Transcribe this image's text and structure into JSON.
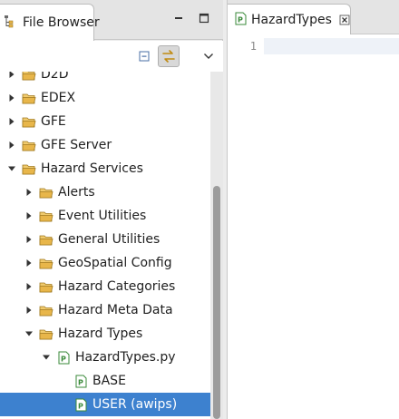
{
  "left_panel": {
    "tab_label": "File Browser",
    "tree": [
      {
        "label": "D2D",
        "depth": 0,
        "expanded": false,
        "type": "folder"
      },
      {
        "label": "EDEX",
        "depth": 0,
        "expanded": false,
        "type": "folder"
      },
      {
        "label": "GFE",
        "depth": 0,
        "expanded": false,
        "type": "folder"
      },
      {
        "label": "GFE Server",
        "depth": 0,
        "expanded": false,
        "type": "folder"
      },
      {
        "label": "Hazard Services",
        "depth": 0,
        "expanded": true,
        "type": "folder"
      },
      {
        "label": "Alerts",
        "depth": 1,
        "expanded": false,
        "type": "folder"
      },
      {
        "label": "Event Utilities",
        "depth": 1,
        "expanded": false,
        "type": "folder"
      },
      {
        "label": "General Utilities",
        "depth": 1,
        "expanded": false,
        "type": "folder"
      },
      {
        "label": "GeoSpatial Config",
        "depth": 1,
        "expanded": false,
        "type": "folder"
      },
      {
        "label": "Hazard Categories",
        "depth": 1,
        "expanded": false,
        "type": "folder"
      },
      {
        "label": "Hazard Meta Data",
        "depth": 1,
        "expanded": false,
        "type": "folder"
      },
      {
        "label": "Hazard Types",
        "depth": 1,
        "expanded": true,
        "type": "folder"
      },
      {
        "label": "HazardTypes.py",
        "depth": 2,
        "expanded": true,
        "type": "pyfile"
      },
      {
        "label": "BASE",
        "depth": 3,
        "expanded": null,
        "type": "pyfile"
      },
      {
        "label": "USER (awips)",
        "depth": 3,
        "expanded": null,
        "type": "pyfile",
        "selected": true
      }
    ]
  },
  "editor": {
    "tab_label": "HazardTypes",
    "line_numbers": [
      "1"
    ]
  },
  "colors": {
    "selection": "#3d81cf",
    "folder": "#e8b64a",
    "pyfile": "#3a8a3a"
  }
}
